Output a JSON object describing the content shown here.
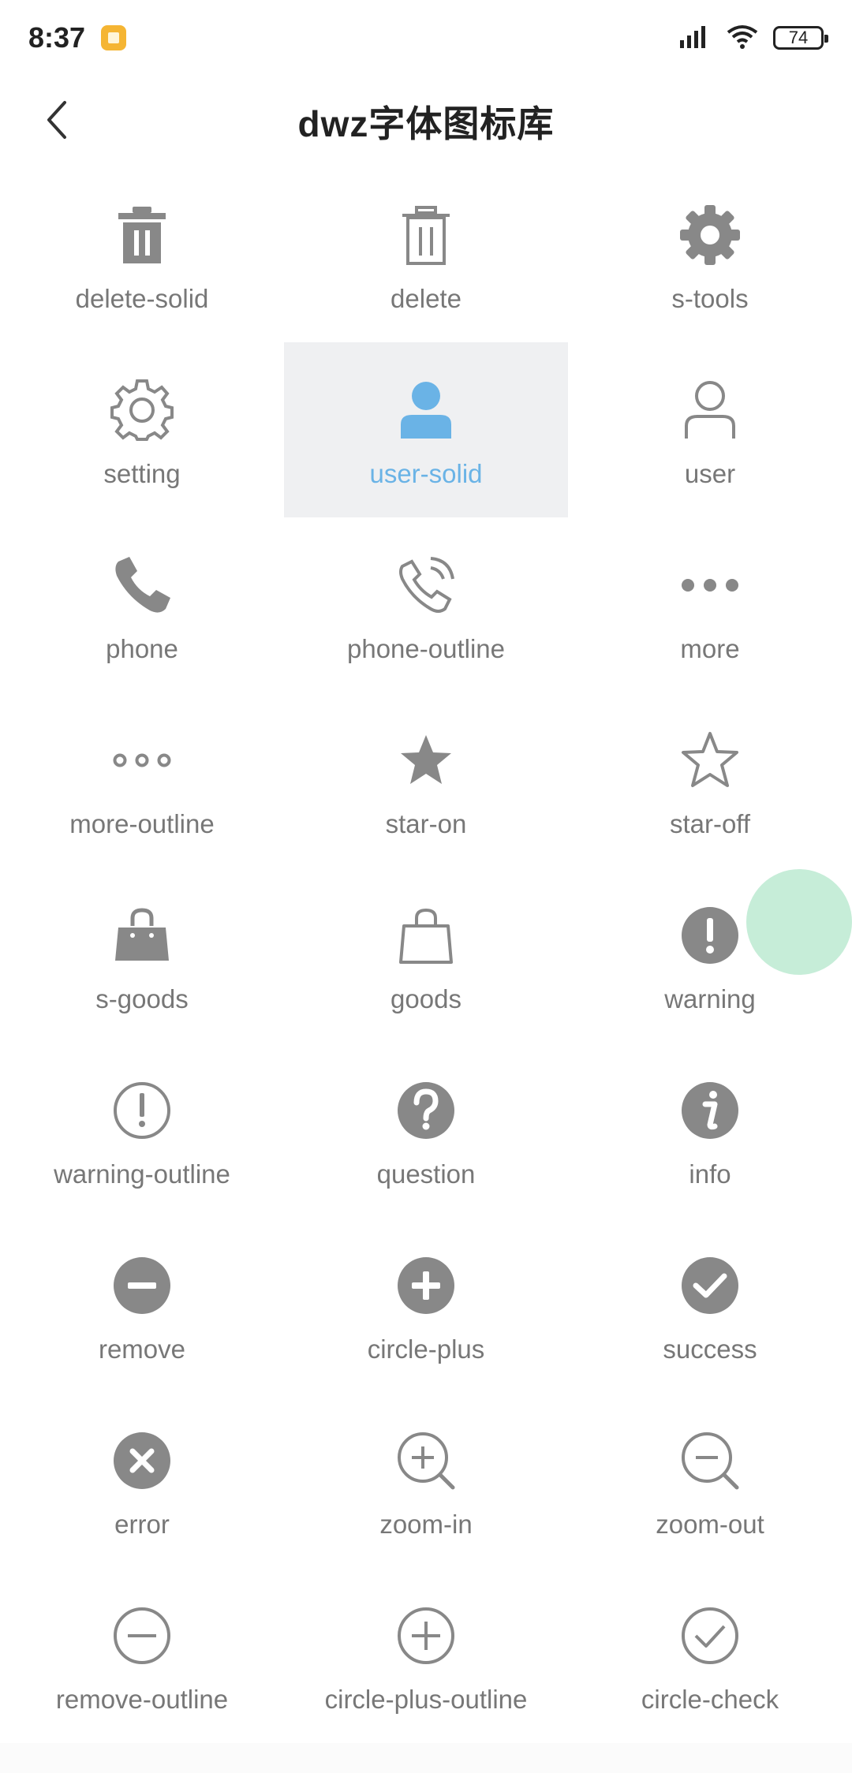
{
  "status": {
    "time": "8:37",
    "battery": "74"
  },
  "header": {
    "title": "dwz字体图标库"
  },
  "icons": [
    {
      "label": "delete-solid"
    },
    {
      "label": "delete"
    },
    {
      "label": "s-tools"
    },
    {
      "label": "setting"
    },
    {
      "label": "user-solid"
    },
    {
      "label": "user"
    },
    {
      "label": "phone"
    },
    {
      "label": "phone-outline"
    },
    {
      "label": "more"
    },
    {
      "label": "more-outline"
    },
    {
      "label": "star-on"
    },
    {
      "label": "star-off"
    },
    {
      "label": "s-goods"
    },
    {
      "label": "goods"
    },
    {
      "label": "warning"
    },
    {
      "label": "warning-outline"
    },
    {
      "label": "question"
    },
    {
      "label": "info"
    },
    {
      "label": "remove"
    },
    {
      "label": "circle-plus"
    },
    {
      "label": "success"
    },
    {
      "label": "error"
    },
    {
      "label": "zoom-in"
    },
    {
      "label": "zoom-out"
    },
    {
      "label": "remove-outline"
    },
    {
      "label": "circle-plus-outline"
    },
    {
      "label": "circle-check"
    }
  ],
  "colors": {
    "icon": "#888888",
    "active": "#6ab3e6",
    "active_bg": "#eff0f2"
  }
}
